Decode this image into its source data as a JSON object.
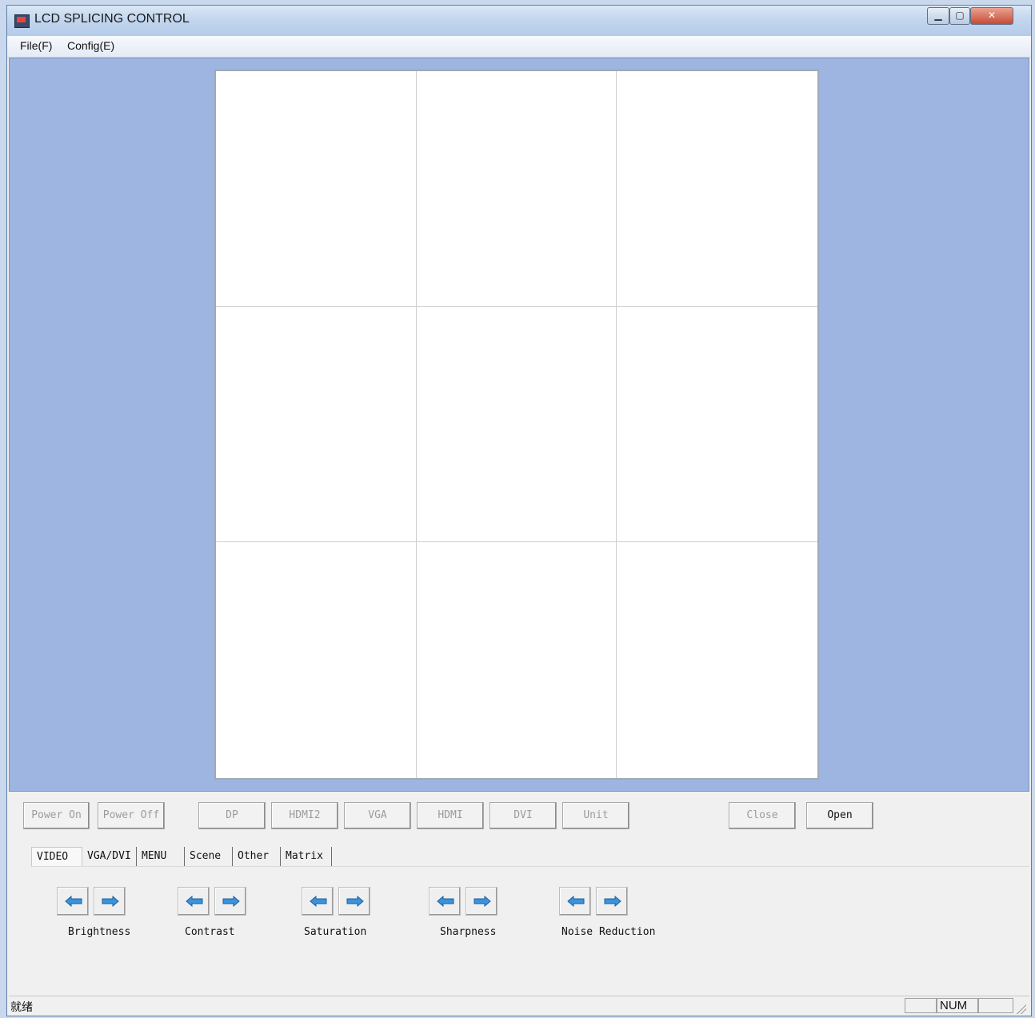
{
  "window": {
    "title": "LCD SPLICING CONTROL"
  },
  "menu": [
    "File(F)",
    "Config(E)"
  ],
  "layout_grid": {
    "rows": 3,
    "cols": 3
  },
  "source_buttons": [
    {
      "label": "Power On",
      "enabled": false
    },
    {
      "label": "Power Off",
      "enabled": false
    },
    {
      "label": "DP",
      "enabled": false
    },
    {
      "label": "HDMI2",
      "enabled": false
    },
    {
      "label": "VGA",
      "enabled": false
    },
    {
      "label": "HDMI",
      "enabled": false
    },
    {
      "label": "DVI",
      "enabled": false
    },
    {
      "label": "Unit",
      "enabled": false
    },
    {
      "label": "Close",
      "enabled": false
    },
    {
      "label": "Open",
      "enabled": true
    }
  ],
  "tabs": [
    "VIDEO",
    "VGA/DVI",
    "MENU",
    "Scene",
    "Other",
    "Matrix"
  ],
  "active_tab": "VIDEO",
  "video_controls": [
    "Brightness",
    "Contrast",
    "Saturation",
    "Sharpness",
    "Noise Reduction"
  ],
  "status": {
    "text": "就绪",
    "num": "NUM"
  },
  "colors": {
    "workspace": "#9db5e0",
    "arrow": "#3a93dc"
  }
}
